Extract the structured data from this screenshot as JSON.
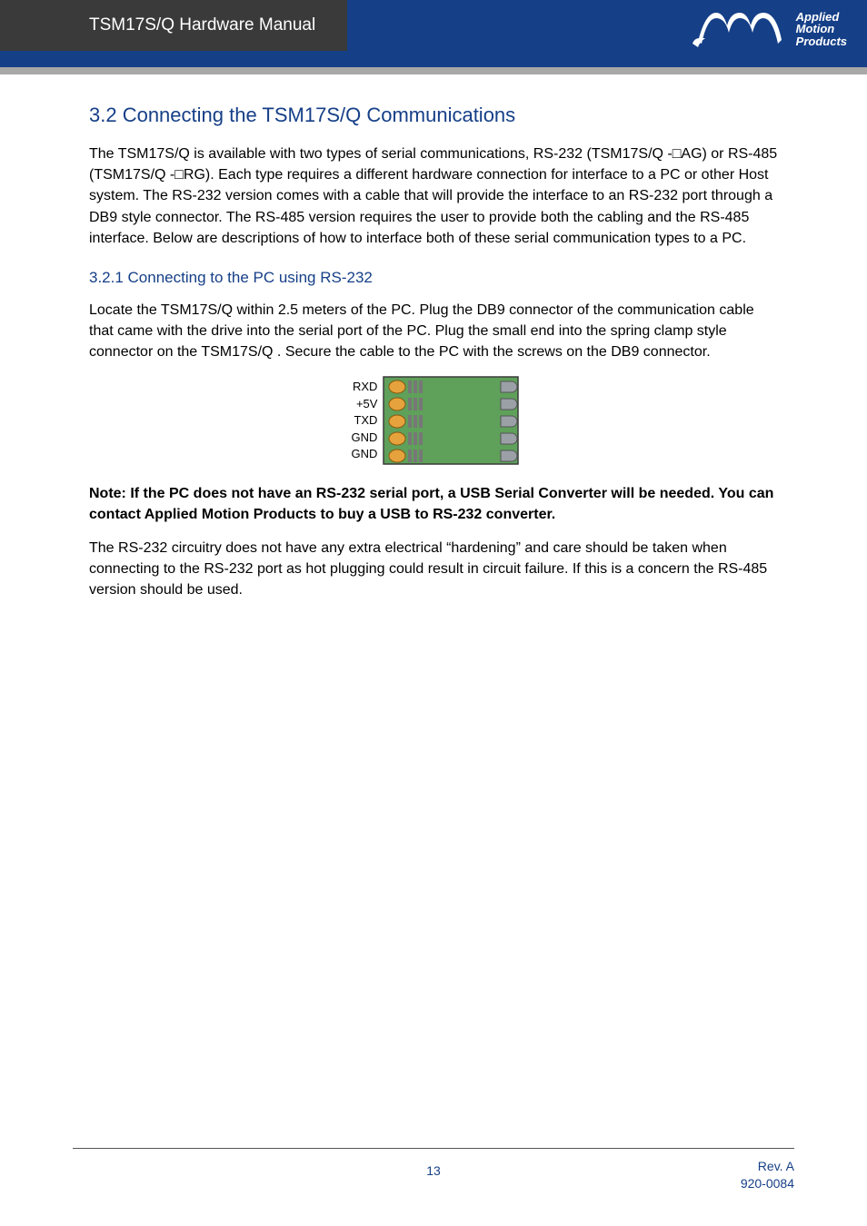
{
  "header": {
    "title": "TSM17S/Q Hardware Manual",
    "brand_line1": "Applied",
    "brand_line2": "Motion",
    "brand_line3": "Products"
  },
  "section": {
    "h2": "3.2  Connecting the TSM17S/Q Communications",
    "p1": "The TSM17S/Q  is available with two types of serial communications, RS-232 (TSM17S/Q -□AG) or RS-485 (TSM17S/Q -□RG). Each type requires a different hardware connection for interface to a PC or other Host system. The RS-232 version comes with a cable that will provide the interface to an RS-232 port through a DB9 style connector. The RS-485 version requires the user to provide both the cabling and the RS-485 interface. Below are descriptions of how to interface both of these serial communication types to a PC.",
    "h3": "3.2.1  Connecting to the PC using RS-232",
    "p2": "Locate the TSM17S/Q  within 2.5 meters of the PC. Plug the DB9 connector of the communication cable that came with the drive into the serial port of the PC. Plug the small end into the spring clamp style connector on the TSM17S/Q . Secure the cable to the PC with the screws on the DB9 connector.",
    "note": "Note: If the PC does not have an RS-232 serial port, a USB Serial Converter will be needed. You can contact Applied Motion Products to buy a USB to RS-232 converter.",
    "p3": "The RS-232 circuitry does not have any extra electrical “hardening” and care should be taken when connecting to the RS-232 port as hot plugging could result in circuit failure. If this is a concern the RS-485 version should be used."
  },
  "connector_labels": [
    "RXD",
    "+5V",
    "TXD",
    "GND",
    "GND"
  ],
  "footer": {
    "page": "13",
    "rev1": "Rev. A",
    "rev2": "920-0084"
  }
}
